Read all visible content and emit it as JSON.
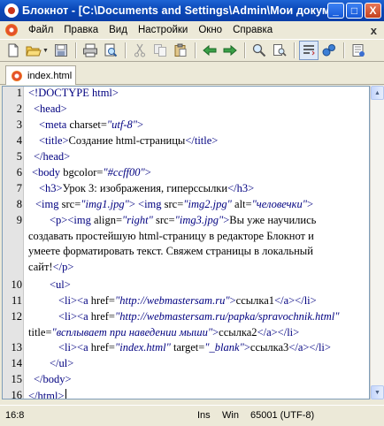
{
  "window": {
    "title": "Блокнот - [C:\\Documents and Settings\\Admin\\Мои докум...",
    "minimize": "_",
    "maximize": "□",
    "close": "X"
  },
  "menu": {
    "items": [
      "Файл",
      "Правка",
      "Вид",
      "Настройки",
      "Окно",
      "Справка"
    ],
    "close": "x"
  },
  "toolbar": {
    "icons": [
      "new-document-icon",
      "open-folder-icon",
      "save-icon",
      "print-icon",
      "print-preview-icon",
      "cut-icon",
      "copy-icon",
      "paste-icon",
      "undo-icon",
      "redo-icon",
      "find-icon",
      "replace-icon",
      "word-wrap-icon",
      "run-icon",
      "help-icon"
    ]
  },
  "tab": {
    "label": "index.html"
  },
  "editor": {
    "line_numbers": [
      "1",
      "2",
      "3",
      "4",
      "5",
      "6",
      "7",
      "8",
      "9",
      "",
      "",
      "",
      "10",
      "11",
      "12",
      "",
      "13",
      "14",
      "15",
      "16"
    ],
    "lines": [
      {
        "n": "1",
        "parts": [
          [
            "tg",
            "<!DOCTYPE html>"
          ]
        ]
      },
      {
        "n": "2",
        "parts": [
          [
            "tg",
            "<head>"
          ]
        ]
      },
      {
        "n": "3",
        "parts": [
          [
            "tg",
            "<meta "
          ],
          [
            "at",
            "charset="
          ],
          [
            "av",
            "\"utf-8\""
          ],
          [
            "tg",
            ">"
          ]
        ]
      },
      {
        "n": "4",
        "parts": [
          [
            "tg",
            "<title>"
          ],
          [
            "tx",
            "Создание  html-страницы"
          ],
          [
            "tg",
            "</title>"
          ]
        ]
      },
      {
        "n": "5",
        "parts": [
          [
            "tg",
            "</head>"
          ]
        ]
      },
      {
        "n": "6",
        "parts": [
          [
            "tg",
            "<body "
          ],
          [
            "at",
            "bgcolor="
          ],
          [
            "av",
            "\"#ccff00\""
          ],
          [
            "tg",
            ">"
          ]
        ]
      },
      {
        "n": "7",
        "parts": [
          [
            "tg",
            "<h3>"
          ],
          [
            "tx",
            "Урок 3: изображения, гиперссылки"
          ],
          [
            "tg",
            "</h3>"
          ]
        ]
      },
      {
        "n": "8",
        "parts": [
          [
            "tg",
            "<img "
          ],
          [
            "at",
            "src="
          ],
          [
            "av",
            "\"img1.jpg\""
          ],
          [
            "tg",
            "> <img "
          ],
          [
            "at",
            "src="
          ],
          [
            "av",
            "\"img2.jpg\""
          ],
          [
            "at",
            " alt="
          ],
          [
            "av",
            "\"человечки\""
          ],
          [
            "tg",
            ">"
          ]
        ]
      },
      {
        "n": "9",
        "parts": [
          [
            "tg",
            "<p><img "
          ],
          [
            "at",
            "align="
          ],
          [
            "av",
            "\"right\""
          ],
          [
            "at",
            " src="
          ],
          [
            "av",
            "\"img3.jpg\""
          ],
          [
            "tg",
            ">"
          ],
          [
            "tx",
            "Вы уже научились"
          ]
        ]
      },
      {
        "n": "",
        "parts": [
          [
            "tx",
            "создавать простейшую html-страницу в редакторе Блокнот и"
          ]
        ]
      },
      {
        "n": "",
        "parts": [
          [
            "tx",
            "умеете форматировать текст. Свяжем страницы в локальный"
          ]
        ]
      },
      {
        "n": "",
        "parts": [
          [
            "tx",
            "сайт!"
          ],
          [
            "tg",
            "</p>"
          ]
        ]
      },
      {
        "n": "10",
        "parts": [
          [
            "tg",
            "<ul>"
          ]
        ]
      },
      {
        "n": "11",
        "parts": [
          [
            "tg",
            "<li><a "
          ],
          [
            "at",
            "href="
          ],
          [
            "av",
            "\"http://webmastersam.ru\""
          ],
          [
            "tg",
            ">"
          ],
          [
            "tx",
            "ссылка1"
          ],
          [
            "tg",
            "</a></li>"
          ]
        ]
      },
      {
        "n": "12",
        "parts": [
          [
            "tg",
            "<li><a "
          ],
          [
            "at",
            "href="
          ],
          [
            "av",
            "\"http://webmastersam.ru/papka/spravochnik.html\""
          ]
        ]
      },
      {
        "n": "",
        "parts": [
          [
            "at",
            "title="
          ],
          [
            "av",
            "\"всплывает при наведении мыши\""
          ],
          [
            "tg",
            ">"
          ],
          [
            "tx",
            "ссылка2"
          ],
          [
            "tg",
            "</a></li>"
          ]
        ]
      },
      {
        "n": "13",
        "parts": [
          [
            "tg",
            "<li><a "
          ],
          [
            "at",
            "href="
          ],
          [
            "av",
            "\"index.html\""
          ],
          [
            "at",
            " target="
          ],
          [
            "av",
            "\"_blank\""
          ],
          [
            "tg",
            ">"
          ],
          [
            "tx",
            "ссылка3"
          ],
          [
            "tg",
            "</a></li>"
          ]
        ]
      },
      {
        "n": "14",
        "parts": [
          [
            "tg",
            "</ul>"
          ]
        ]
      },
      {
        "n": "15",
        "parts": [
          [
            "tg",
            "</body>"
          ]
        ]
      },
      {
        "n": "16",
        "parts": [
          [
            "tg",
            "</html>"
          ]
        ]
      }
    ]
  },
  "status": {
    "position": "16:8",
    "mode": "Ins",
    "line_endings": "Win",
    "encoding": "65001 (UTF-8)"
  }
}
